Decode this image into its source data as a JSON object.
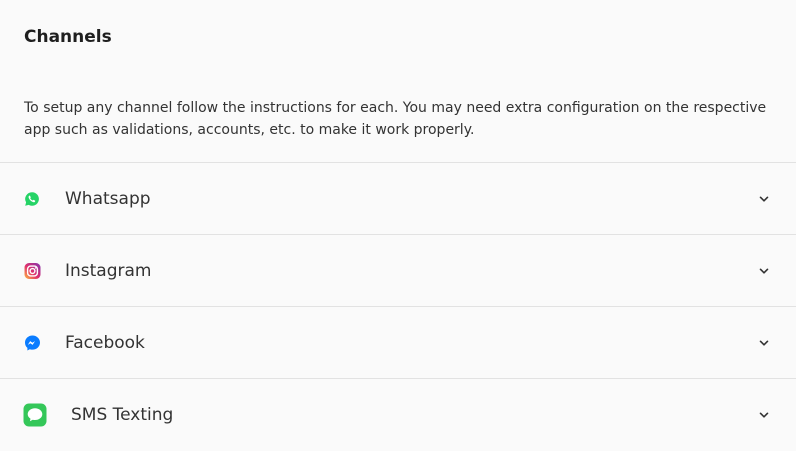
{
  "header": {
    "title": "Channels"
  },
  "description": "To setup any channel follow the instructions for each. You may need extra configuration on the respective app such as validations, accounts, etc. to make it work properly.",
  "channels": [
    {
      "label": "Whatsapp",
      "icon": "whatsapp-icon",
      "color": "#25d366"
    },
    {
      "label": "Instagram",
      "icon": "instagram-icon",
      "color": "#d6249f"
    },
    {
      "label": "Facebook",
      "icon": "messenger-icon",
      "color": "#0a7cff"
    },
    {
      "label": "SMS Texting",
      "icon": "sms-icon",
      "color": "#34c759"
    }
  ]
}
